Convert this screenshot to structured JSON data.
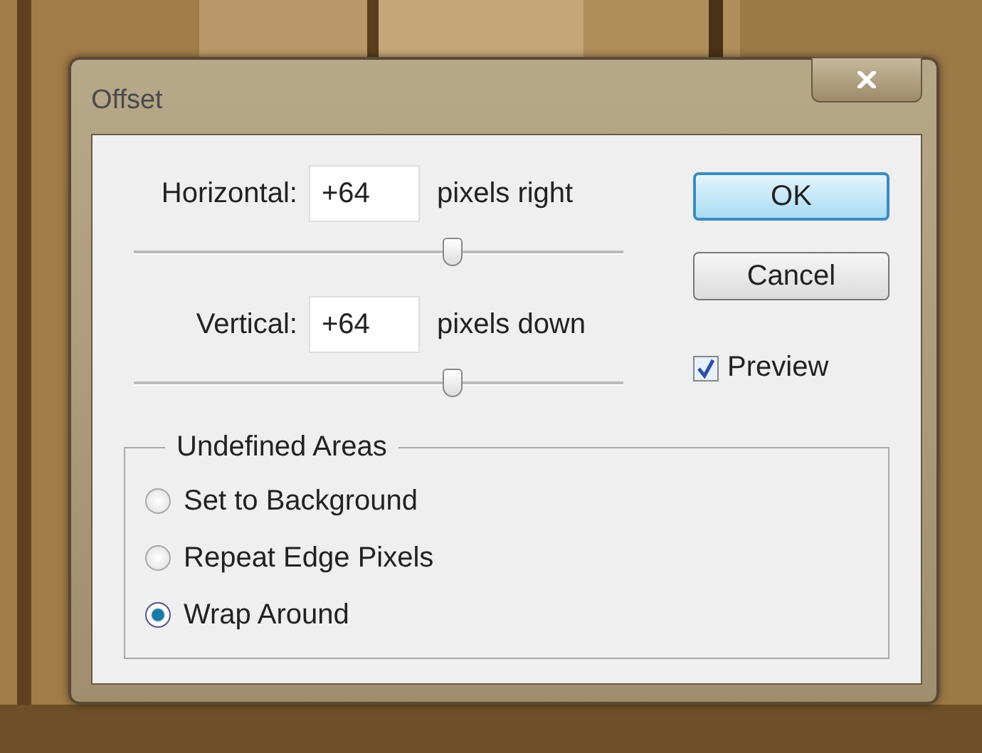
{
  "window": {
    "title": "Offset"
  },
  "offsets": [
    {
      "label": "Horizontal:",
      "value": "+64",
      "unit": "pixels right",
      "level": 0.65
    },
    {
      "label": "Vertical:",
      "value": "+64",
      "unit": "pixels down",
      "level": 0.65
    }
  ],
  "buttons": [
    {
      "label": "OK",
      "default": true
    },
    {
      "label": "Cancel",
      "default": false
    }
  ],
  "preview": {
    "label": "Preview",
    "checked": true
  },
  "undefined_areas": {
    "title": "Undefined Areas",
    "options": [
      {
        "label": "Set to Background",
        "selected": false
      },
      {
        "label": "Repeat Edge Pixels",
        "selected": false
      },
      {
        "label": "Wrap Around",
        "selected": true
      }
    ]
  }
}
